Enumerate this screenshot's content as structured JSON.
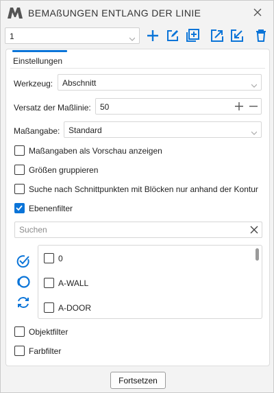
{
  "window": {
    "title": "BEMAßUNGEN ENTLANG DER LINIE"
  },
  "icons": {
    "logo": "app-logo-icon",
    "close": "close-icon",
    "add": "plus-icon",
    "edit": "edit-icon",
    "duplicate": "duplicate-icon",
    "export": "export-icon",
    "import": "import-icon",
    "delete": "trash-icon",
    "select_all": "select-all-icon",
    "deselect": "deselect-circle-icon",
    "invert": "invert-selection-icon"
  },
  "colors": {
    "accent": "#0a74d8"
  },
  "toolbar": {
    "preset_value": "1"
  },
  "tabs": [
    {
      "label": "Einstellungen",
      "active": true
    }
  ],
  "form": {
    "tool_label": "Werkzeug:",
    "tool_value": "Abschnitt",
    "offset_label": "Versatz der Maßlinie:",
    "offset_value": "50",
    "format_label": "Maßangabe:",
    "format_value": "Standard"
  },
  "checkboxes": [
    {
      "label": "Maßangaben als Vorschau anzeigen",
      "checked": false
    },
    {
      "label": "Größen gruppieren",
      "checked": false
    },
    {
      "label": "Suche nach Schnittpunkten mit Blöcken nur anhand der Kontur",
      "checked": false
    },
    {
      "label": "Ebenenfilter",
      "checked": true
    }
  ],
  "search": {
    "placeholder": "Suchen"
  },
  "layers": [
    {
      "label": "0",
      "checked": false
    },
    {
      "label": "A-WALL",
      "checked": false
    },
    {
      "label": "A-DOOR",
      "checked": false
    }
  ],
  "filters": [
    {
      "label": "Objektfilter",
      "checked": false
    },
    {
      "label": "Farbfilter",
      "checked": false
    }
  ],
  "footer": {
    "continue_label": "Fortsetzen"
  }
}
